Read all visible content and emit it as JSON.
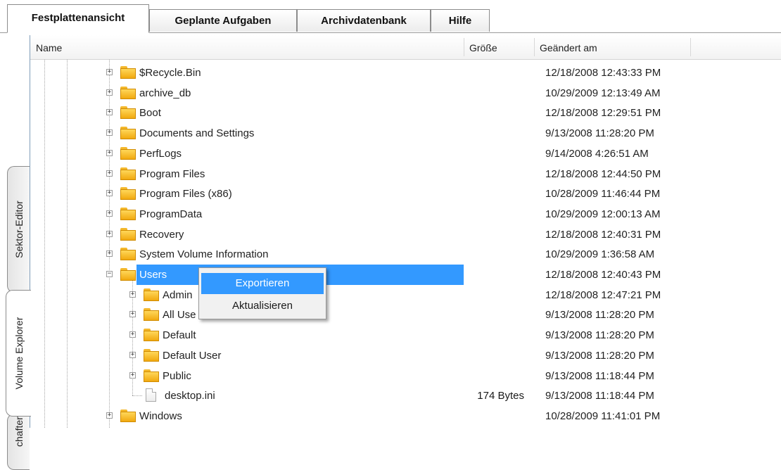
{
  "tabs": [
    {
      "label": "Festplattenansicht",
      "active": true
    },
    {
      "label": "Geplante Aufgaben",
      "active": false
    },
    {
      "label": "Archivdatenbank",
      "active": false
    },
    {
      "label": "Hilfe",
      "active": false
    }
  ],
  "side_tabs": [
    {
      "label": "Sektor-Editor",
      "active": false
    },
    {
      "label": "Volume Explorer",
      "active": true
    },
    {
      "label": "chaften",
      "active": false
    }
  ],
  "columns": {
    "name": "Name",
    "size": "Größe",
    "modified": "Geändert am"
  },
  "rows": [
    {
      "name": "$Recycle.Bin",
      "type": "folder",
      "expander": "+",
      "size": "",
      "date": "12/18/2008 12:43:33 PM",
      "selected": false
    },
    {
      "name": "archive_db",
      "type": "folder",
      "expander": "+",
      "size": "",
      "date": "10/29/2009 12:13:49 AM",
      "selected": false
    },
    {
      "name": "Boot",
      "type": "folder",
      "expander": "+",
      "size": "",
      "date": "12/18/2008 12:29:51 PM",
      "selected": false
    },
    {
      "name": "Documents and Settings",
      "type": "folder",
      "expander": "+",
      "size": "",
      "date": "9/13/2008 11:28:20 PM",
      "selected": false
    },
    {
      "name": "PerfLogs",
      "type": "folder",
      "expander": "+",
      "size": "",
      "date": "9/14/2008 4:26:51 AM",
      "selected": false
    },
    {
      "name": "Program Files",
      "type": "folder",
      "expander": "+",
      "size": "",
      "date": "12/18/2008 12:44:50 PM",
      "selected": false
    },
    {
      "name": "Program Files (x86)",
      "type": "folder",
      "expander": "+",
      "size": "",
      "date": "10/28/2009 11:46:44 PM",
      "selected": false
    },
    {
      "name": "ProgramData",
      "type": "folder",
      "expander": "+",
      "size": "",
      "date": "10/29/2009 12:00:13 AM",
      "selected": false
    },
    {
      "name": "Recovery",
      "type": "folder",
      "expander": "+",
      "size": "",
      "date": "12/18/2008 12:40:31 PM",
      "selected": false
    },
    {
      "name": "System Volume Information",
      "type": "folder",
      "expander": "+",
      "size": "",
      "date": "10/29/2009 1:36:58 AM",
      "selected": false
    },
    {
      "name": "Users",
      "type": "folder",
      "expander": "−",
      "size": "",
      "date": "12/18/2008 12:40:43 PM",
      "selected": true
    },
    {
      "name": "Admin",
      "type": "folder",
      "expander": "+",
      "size": "",
      "date": "12/18/2008 12:47:21 PM",
      "selected": false
    },
    {
      "name": "All Use",
      "type": "folder",
      "expander": "+",
      "size": "",
      "date": "9/13/2008 11:28:20 PM",
      "selected": false
    },
    {
      "name": "Default",
      "type": "folder",
      "expander": "+",
      "size": "",
      "date": "9/13/2008 11:28:20 PM",
      "selected": false
    },
    {
      "name": "Default User",
      "type": "folder",
      "expander": "+",
      "size": "",
      "date": "9/13/2008 11:28:20 PM",
      "selected": false
    },
    {
      "name": "Public",
      "type": "folder",
      "expander": "+",
      "size": "",
      "date": "9/13/2008 11:18:44 PM",
      "selected": false
    },
    {
      "name": "desktop.ini",
      "type": "file",
      "expander": "",
      "size": "174 Bytes",
      "date": "9/13/2008 11:18:44 PM",
      "selected": false
    },
    {
      "name": "Windows",
      "type": "folder",
      "expander": "+",
      "size": "",
      "date": "10/28/2009 11:41:01 PM",
      "selected": false
    }
  ],
  "context_menu": {
    "items": [
      {
        "label": "Exportieren",
        "highlighted": true
      },
      {
        "label": "Aktualisieren",
        "highlighted": false
      }
    ]
  },
  "colors": {
    "selection": "#3399ff",
    "folder": "#f4b82c",
    "tab_border": "#8c8c8c"
  }
}
